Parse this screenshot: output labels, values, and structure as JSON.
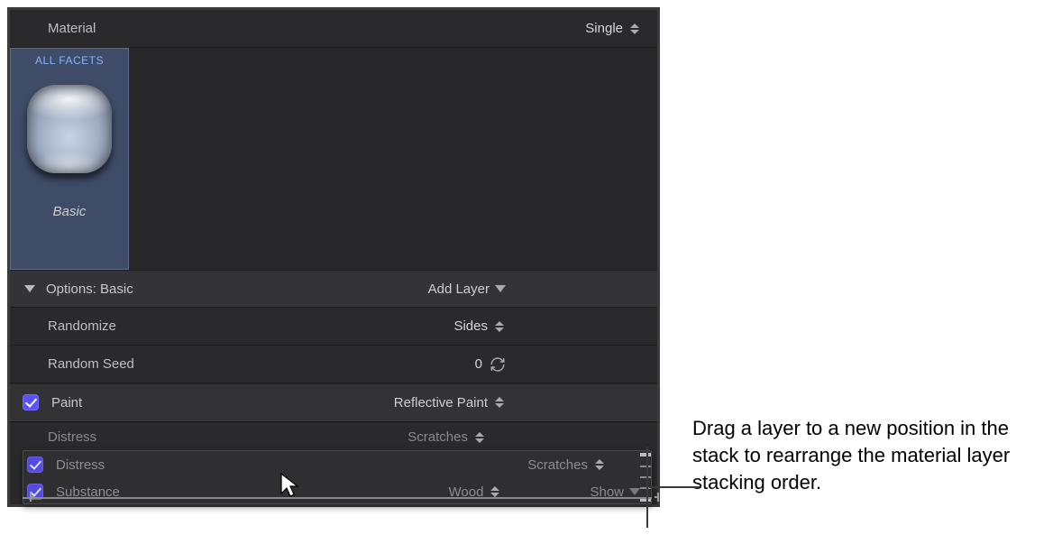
{
  "header": {
    "label": "Material",
    "mode": "Single"
  },
  "facet": {
    "title": "ALL FACETS",
    "name": "Basic"
  },
  "options": {
    "label": "Options: Basic",
    "add_layer": "Add Layer"
  },
  "props": {
    "randomize_label": "Randomize",
    "randomize_value": "Sides",
    "seed_label": "Random Seed",
    "seed_value": "0"
  },
  "layers": {
    "paint": {
      "label": "Paint",
      "value": "Reflective Paint"
    },
    "distress": {
      "label": "Distress",
      "value": "Scratches"
    },
    "substance": {
      "label": "Substance",
      "value": "Wood",
      "show": "Show"
    }
  },
  "annotation": "Drag a layer to a new position in the stack to rearrange the material layer stacking order."
}
